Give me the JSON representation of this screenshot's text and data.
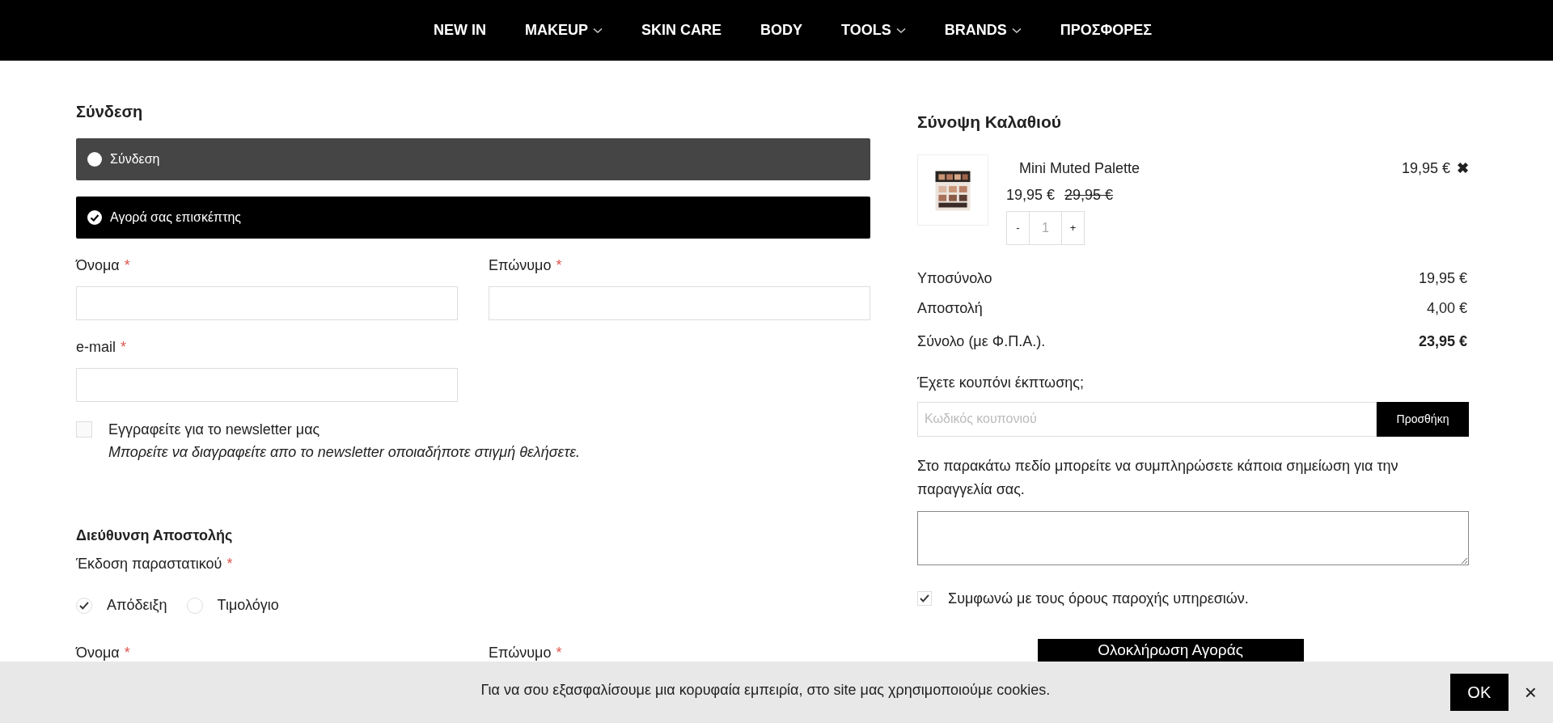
{
  "nav": [
    {
      "label": "NEW IN",
      "dropdown": false
    },
    {
      "label": "MAKEUP",
      "dropdown": true
    },
    {
      "label": "SKIN CARE",
      "dropdown": false
    },
    {
      "label": "BODY",
      "dropdown": false
    },
    {
      "label": "TOOLS",
      "dropdown": true
    },
    {
      "label": "BRANDS",
      "dropdown": true
    },
    {
      "label": "ΠΡΟΣΦΟΡΕΣ",
      "dropdown": false
    }
  ],
  "required_mark": "*",
  "login": {
    "title": "Σύνδεση",
    "options": [
      {
        "label": "Σύνδεση",
        "selected": false
      },
      {
        "label": "Αγορά σας επισκέπτης",
        "selected": true
      }
    ],
    "fields": [
      {
        "label": "Όνομα",
        "required": true
      },
      {
        "label": "Επώνυμο",
        "required": true
      },
      {
        "label": "e-mail",
        "required": true
      }
    ],
    "newsletter": {
      "label": "Εγγραφείτε για το newsletter μας",
      "note": "Μπορείτε να διαγραφείτε απο το newsletter οποιαδήποτε στιγμή θελήσετε.",
      "checked": false
    }
  },
  "shipping": {
    "title": "Διεύθυνση Αποστολής",
    "document_label": "Έκδοση παραστατικού",
    "document_required": true,
    "document_options": [
      {
        "label": "Απόδειξη",
        "selected": true
      },
      {
        "label": "Τιμολόγιο",
        "selected": false
      }
    ],
    "fields": [
      {
        "label": "Όνομα",
        "required": true
      },
      {
        "label": "Επώνυμο",
        "required": true
      }
    ]
  },
  "cart": {
    "title": "Σύνοψη Καλαθιού",
    "items": [
      {
        "name": "Mini Muted Palette",
        "line_total": "19,95 €",
        "remove": "✖",
        "price": "19,95 €",
        "old_price": "29,95 €",
        "decrement": "-",
        "quantity": "1",
        "increment": "+"
      }
    ],
    "totals": [
      {
        "label": "Υποσύνολο",
        "value": "19,95 €",
        "kind": "line"
      },
      {
        "label": "Αποστολή",
        "value": "4,00 €",
        "kind": "line"
      },
      {
        "label": "Σύνολο (με Φ.Π.Α.).",
        "value": "23,95 €",
        "kind": "total"
      }
    ],
    "coupon": {
      "question": "Έχετε κουπόνι έκπτωσης;",
      "placeholder": "Κωδικός κουπονιού",
      "button": "Προσθήκη"
    },
    "note_prompt": "Στο παρακάτω πεδίο μπορείτε να συμπληρώσετε κάποια σημείωση για την παραγγελία σας.",
    "terms": {
      "label": "Συμφωνώ με τους όρους παροχής υπηρεσιών.",
      "checked": true
    },
    "checkout_button": "Ολοκλήρωση Αγοράς"
  },
  "cookie_bar": {
    "text": "Για να σου εξασφαλίσουμε μια κορυφαία εμπειρία, στο site μας χρησιμοποιούμε cookies.",
    "ok": "OK",
    "close": "×"
  }
}
